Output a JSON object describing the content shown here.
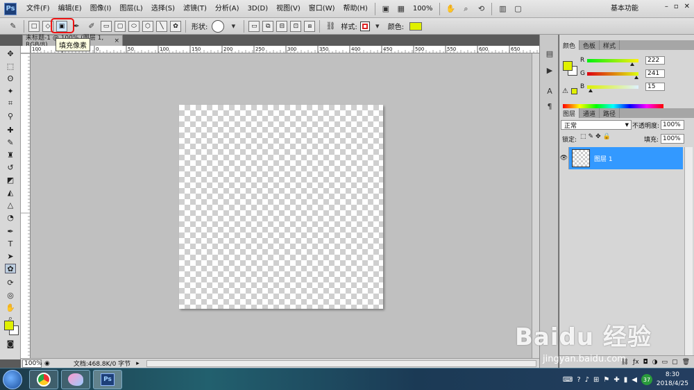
{
  "app": {
    "logo": "Ps"
  },
  "menu": [
    "文件(F)",
    "编辑(E)",
    "图像(I)",
    "图层(L)",
    "选择(S)",
    "滤镜(T)",
    "分析(A)",
    "3D(D)",
    "视图(V)",
    "窗口(W)",
    "帮助(H)"
  ],
  "menubar": {
    "zoom": "100%",
    "workspace": "基本功能",
    "win_min": "–",
    "win_max": "▫",
    "win_close": "✕"
  },
  "options": {
    "shape_label": "形状:",
    "style_label": "样式:",
    "color_label": "颜色:",
    "color": "#e0f000",
    "tooltip": "填充像素"
  },
  "document": {
    "tab": "未标题-1 @ 100% (图层 1, RGB/8)",
    "close": "×"
  },
  "status": {
    "zoom": "100%",
    "doc_info": "文档:468.8K/0 字节"
  },
  "ruler": {
    "top_ticks": [
      "100",
      "50",
      "0",
      "50",
      "100",
      "150",
      "200",
      "250",
      "300",
      "350",
      "400",
      "450",
      "500",
      "550",
      "600",
      "650"
    ]
  },
  "colors": {
    "foreground": "#e0f000",
    "background": "#ffffff",
    "accent": "#3399ff"
  },
  "color_panel": {
    "tabs": [
      "颜色",
      "色板",
      "样式"
    ],
    "r_label": "R",
    "r": "222",
    "g_label": "G",
    "g": "241",
    "b_label": "B",
    "b": "15"
  },
  "layers_panel": {
    "tabs": [
      "图层",
      "通道",
      "路径"
    ],
    "blend_mode": "正常",
    "opacity_label": "不透明度:",
    "opacity": "100%",
    "lock_label": "锁定:",
    "fill_label": "填充:",
    "fill": "100%",
    "layer_name": "图层 1"
  },
  "taskbar": {
    "tray_badge": "37",
    "time": "8:30",
    "date": "2018/4/25"
  },
  "watermark": {
    "main": "Baidu 经验",
    "sub": "jingyan.baidu.com"
  }
}
